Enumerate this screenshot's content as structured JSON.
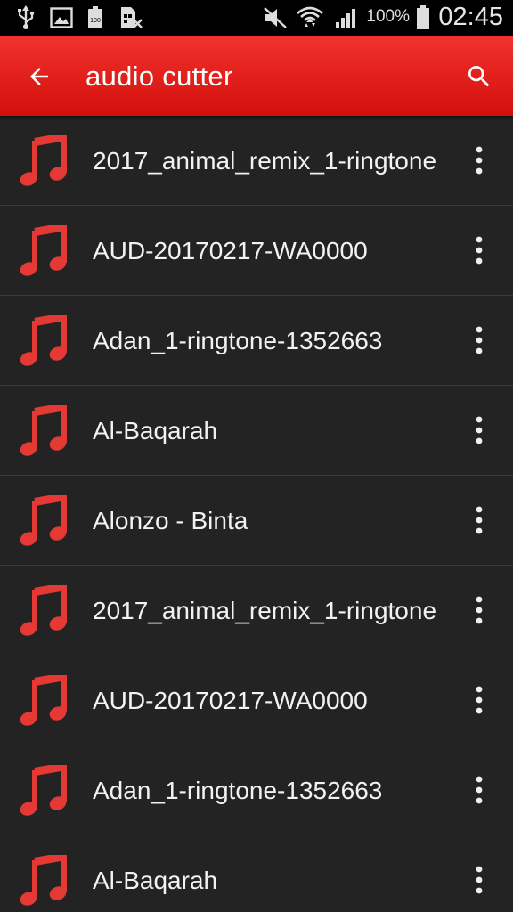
{
  "status_bar": {
    "battery_percent": "100%",
    "time": "02:45",
    "icons": [
      "usb-icon",
      "image-icon",
      "battery-saver-icon",
      "no-sim-icon",
      "mute-icon",
      "wifi-icon",
      "signal-icon",
      "battery-icon"
    ]
  },
  "toolbar": {
    "title": "audio cutter",
    "back_icon": "arrow-back-icon",
    "search_icon": "search-icon",
    "background_color": "#e21f1b"
  },
  "list": {
    "accent_color": "#e53935",
    "item_icon": "music-note-icon",
    "more_icon": "more-vert-icon",
    "items": [
      {
        "title": "2017_animal_remix_1-ringtone"
      },
      {
        "title": "AUD-20170217-WA0000"
      },
      {
        "title": "Adan_1-ringtone-1352663"
      },
      {
        "title": "Al-Baqarah"
      },
      {
        "title": "Alonzo - Binta"
      },
      {
        "title": "2017_animal_remix_1-ringtone"
      },
      {
        "title": "AUD-20170217-WA0000"
      },
      {
        "title": "Adan_1-ringtone-1352663"
      },
      {
        "title": "Al-Baqarah"
      }
    ]
  }
}
